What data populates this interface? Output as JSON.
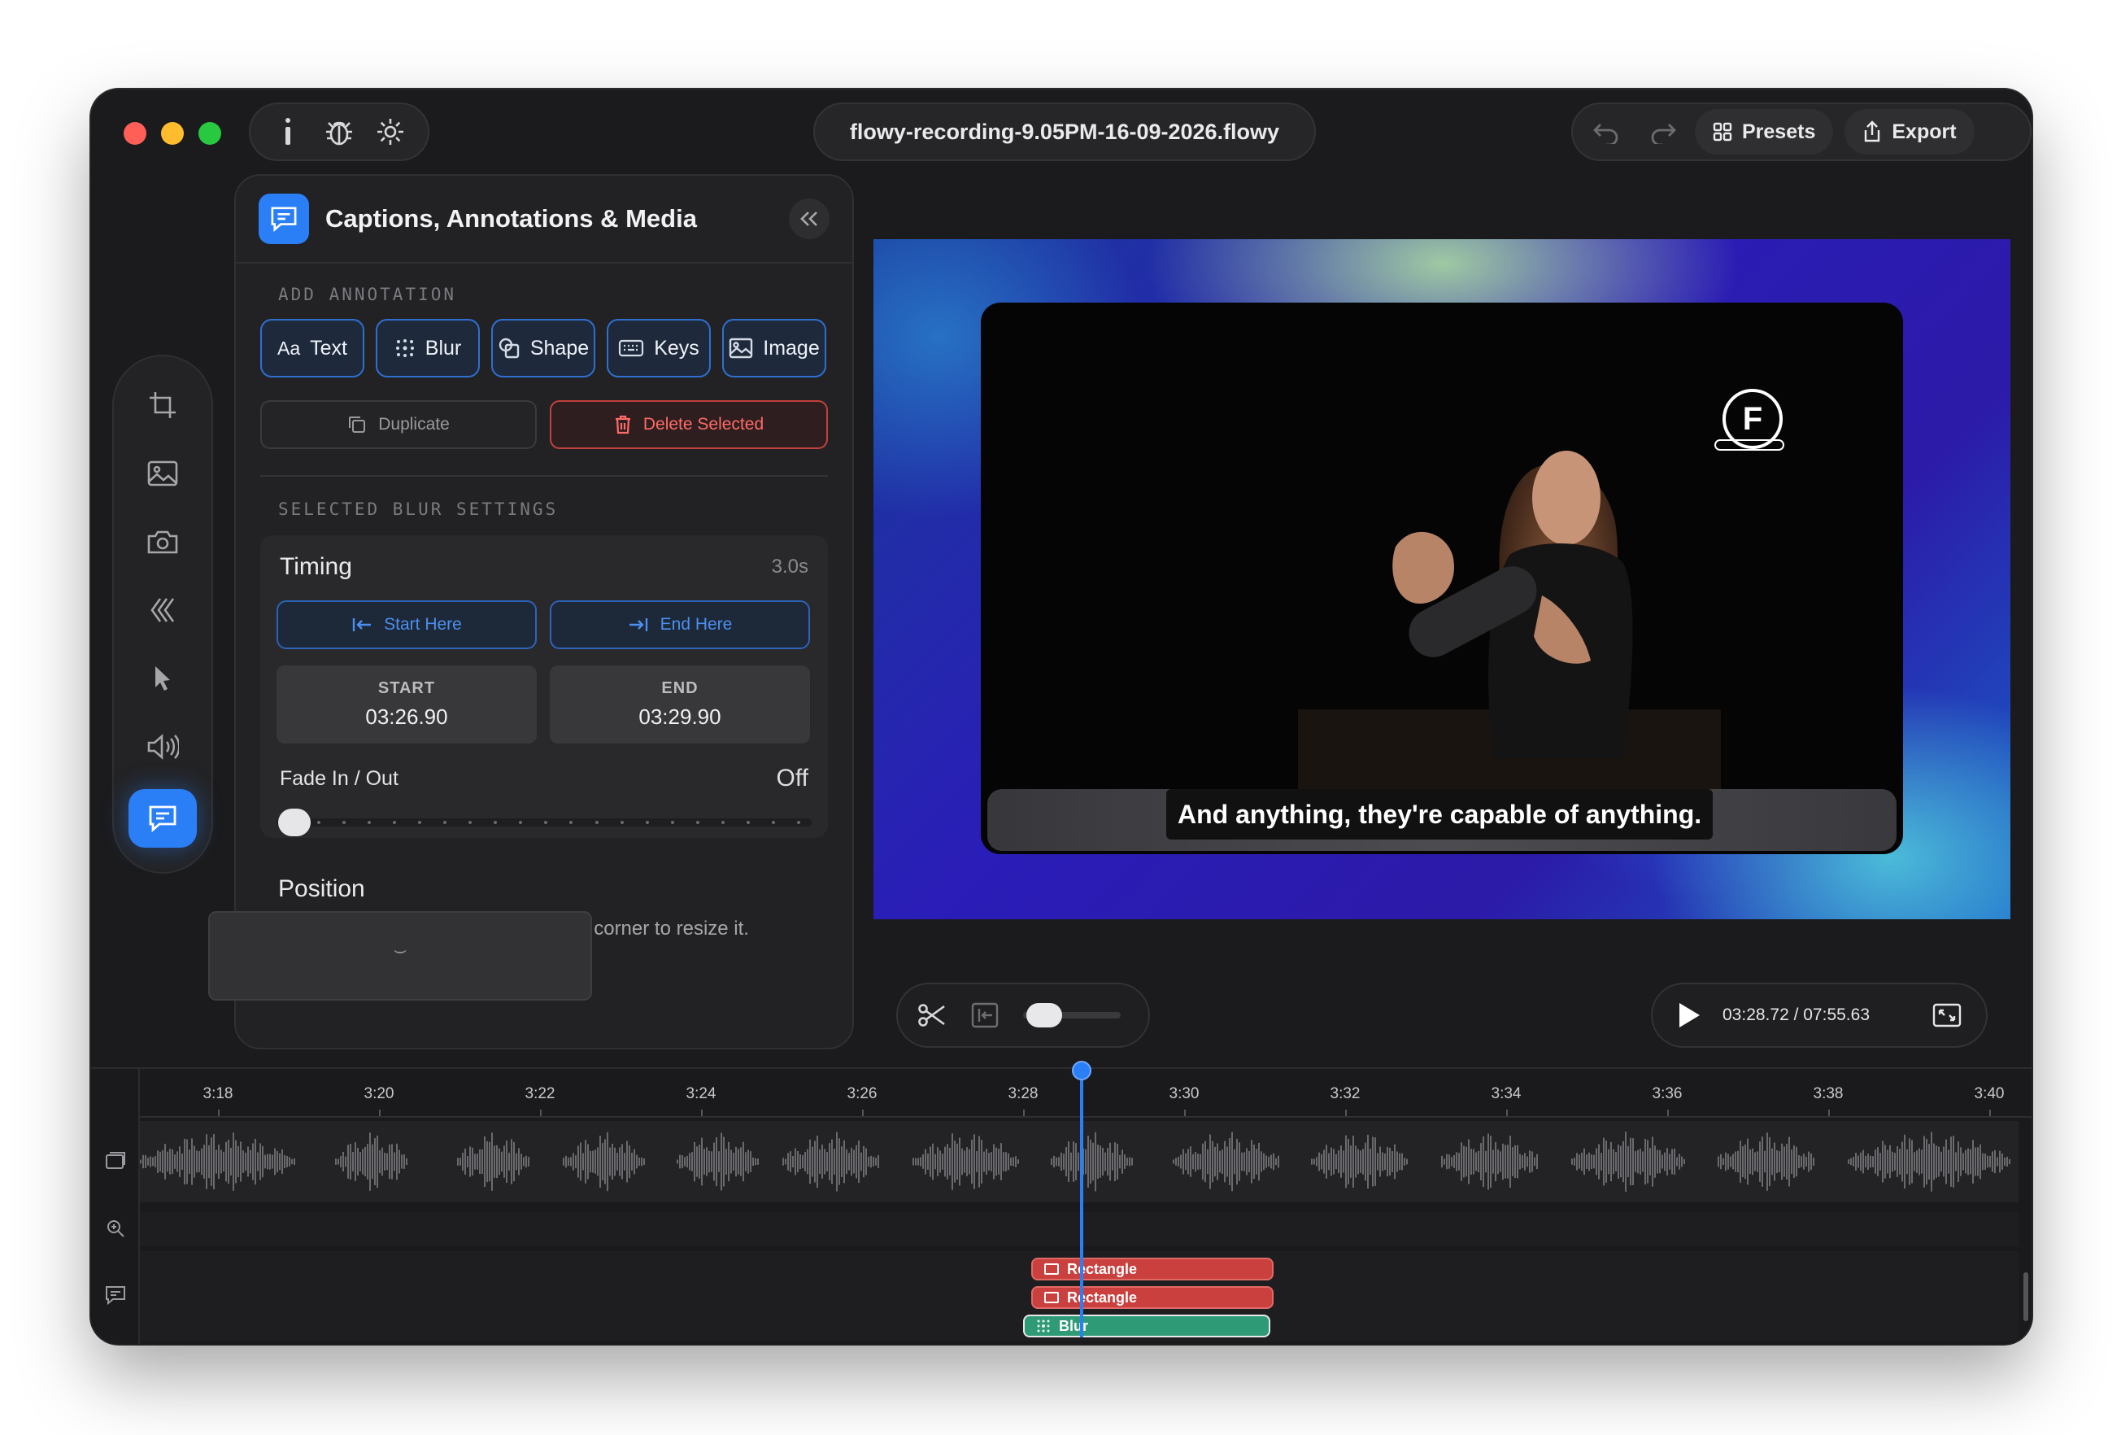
{
  "window": {
    "filename": "flowy-recording-9.05PM-16-09-2026.flowy"
  },
  "toolbar": {
    "info_icon": "info-icon",
    "bug_icon": "bug-icon",
    "settings_icon": "gear-icon",
    "presets_label": "Presets",
    "export_label": "Export"
  },
  "dock": {
    "items": [
      "crop-icon",
      "image-icon",
      "camera-icon",
      "transition-icon",
      "cursor-icon",
      "audio-icon",
      "captions-icon"
    ],
    "active": "captions-icon"
  },
  "panel": {
    "title": "Captions, Annotations & Media",
    "add_annotation_label": "ADD ANNOTATION",
    "annotation_buttons": [
      {
        "label": "Text",
        "prefix": "Aa"
      },
      {
        "label": "Blur"
      },
      {
        "label": "Shape"
      },
      {
        "label": "Keys"
      },
      {
        "label": "Image"
      }
    ],
    "duplicate_label": "Duplicate",
    "delete_label": "Delete Selected",
    "selected_section_label": "SELECTED BLUR SETTINGS",
    "timing": {
      "title": "Timing",
      "duration": "3.0s",
      "start_here": "Start Here",
      "end_here": "End Here",
      "start_label": "START",
      "start_value": "03:26.90",
      "end_label": "END",
      "end_value": "03:29.90"
    },
    "fade": {
      "label": "Fade In / Out",
      "value": "Off",
      "level": 0
    },
    "position": {
      "title": "Position",
      "description": "Drag the box to position it, or drag a corner to resize it.",
      "handle": "⌣"
    }
  },
  "preview": {
    "caption": "And anything, they're capable of anything.",
    "watermark": "F"
  },
  "playback": {
    "current": "03:28.72",
    "total": "07:55.63",
    "readout": "03:28.72 / 07:55.63"
  },
  "timeline": {
    "ticks": [
      "3:18",
      "3:20",
      "3:22",
      "3:24",
      "3:26",
      "3:28",
      "3:30",
      "3:32",
      "3:34",
      "3:36",
      "3:38",
      "3:40"
    ],
    "clips": [
      {
        "label": "Rectangle",
        "type": "shape",
        "color": "#c9403e"
      },
      {
        "label": "Rectangle",
        "type": "shape",
        "color": "#c9403e"
      },
      {
        "label": "Blur",
        "type": "blur",
        "color": "#2e9a76"
      }
    ]
  }
}
